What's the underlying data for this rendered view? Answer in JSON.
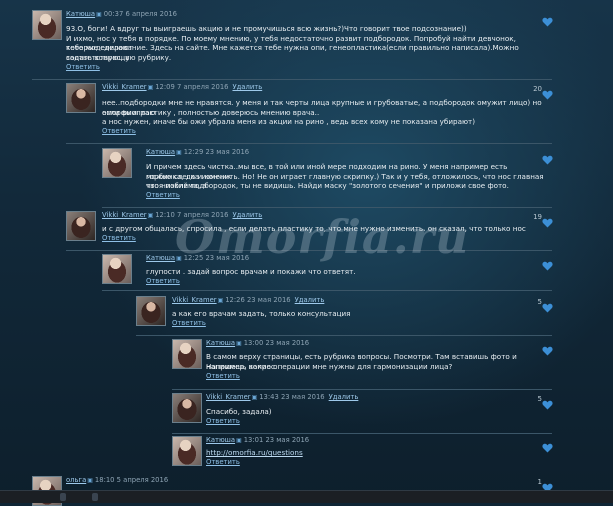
{
  "watermark": "Omorfia.ru",
  "colors": {
    "accent": "#9ec9ea",
    "background": "#12293a",
    "heart": "#3c8fd6"
  },
  "comments": [
    {
      "user": "Катюша",
      "time": "00:37 6 апреля 2016",
      "lines": [
        "93.О, боги! А вдруг ты выиграешь акцию и не промучишься всю жизнь?)Что говорит твое подсознание))",
        "И ихмо, нос у тебя в порядке. По моему мнению, у тебя недостаточно развит подбородок. Попробуй найти девчонок, которые сделают",
        "тебе моделирование. Здесь на сайте. Мне кажется тебе нужна опи, генеопластика(если правильно написала).Можно задать вопрос, в",
        "соответствующую рубрику."
      ],
      "reply": "Ответить"
    },
    {
      "user": "Vikki_Kramer",
      "time": "12:09 7 апреля 2016",
      "delete": "Удалить",
      "likes": "20",
      "lines": [
        "нее..подбородки мне не нравятся. у меня и так черты лица крупные и грубоватые, а подбородок омужит лицо) но если выиграю",
        "оморфиопластику , полностью доверюсь мнению врача..",
        "а нос нужен, иначе бы ожи убрала меня из акции на рино , ведь всех кому не показана убирают)"
      ],
      "reply": "Ответить"
    },
    {
      "user": "Катюша",
      "time": "12:29 23 мая 2016",
      "lines": [
        "И причем здесь чистка..мы все, в той или иной мере подходим на рино. У меня например есть горбинка, да и кончик",
        "можно слегка изменить. Но! Не он играет главную скрипку.) Так и у тебя, отложилось, что нос главная твоя поблема, а",
        "что низкий подбородок, ты не видишь. Найди маску \"золотого сечения\" и приложи свое фото."
      ],
      "reply": "Ответить"
    },
    {
      "user": "Vikki_Kramer",
      "time": "12:10 7 апреля 2016",
      "delete": "Удалить",
      "likes": "19",
      "lines": [
        "и с другом общалась, спросила , если делать пластику то, что мне нужно изменить. он сказал, что только нос"
      ],
      "reply": "Ответить"
    },
    {
      "user": "Катюша",
      "time": "12:25 23 мая 2016",
      "lines": [
        "глупости . задай вопрос врачам и покажи что ответят."
      ],
      "reply": "Ответить"
    },
    {
      "user": "Vikki_Kramer",
      "time": "12:26 23 мая 2016",
      "delete": "Удалить",
      "likes": "5",
      "lines": [
        "а как его врачам задать, только консультация"
      ],
      "reply": "Ответить"
    },
    {
      "user": "Катюша",
      "time": "13:00 23 мая 2016",
      "lines": [
        "В самом верху страницы, есть рубрика вопросы. Посмотри. Там вставишь фото и напишешь вопрос.",
        "Например, какие операции мне нужны для гармонизации лица?"
      ],
      "reply": "Ответить"
    },
    {
      "user": "Vikki_Kramer",
      "time": "13:43 23 мая 2016",
      "delete": "Удалить",
      "likes": "5",
      "lines": [
        "Спасибо, задала)"
      ],
      "reply": "Ответить"
    },
    {
      "user": "Катюша",
      "time": "13:01 23 мая 2016",
      "lines": [
        "http://omorfia.ru/questions"
      ],
      "reply": "Ответить"
    },
    {
      "user": "ольга",
      "time": "18:10 5 апреля 2016",
      "likes": "1",
      "lines": []
    }
  ]
}
